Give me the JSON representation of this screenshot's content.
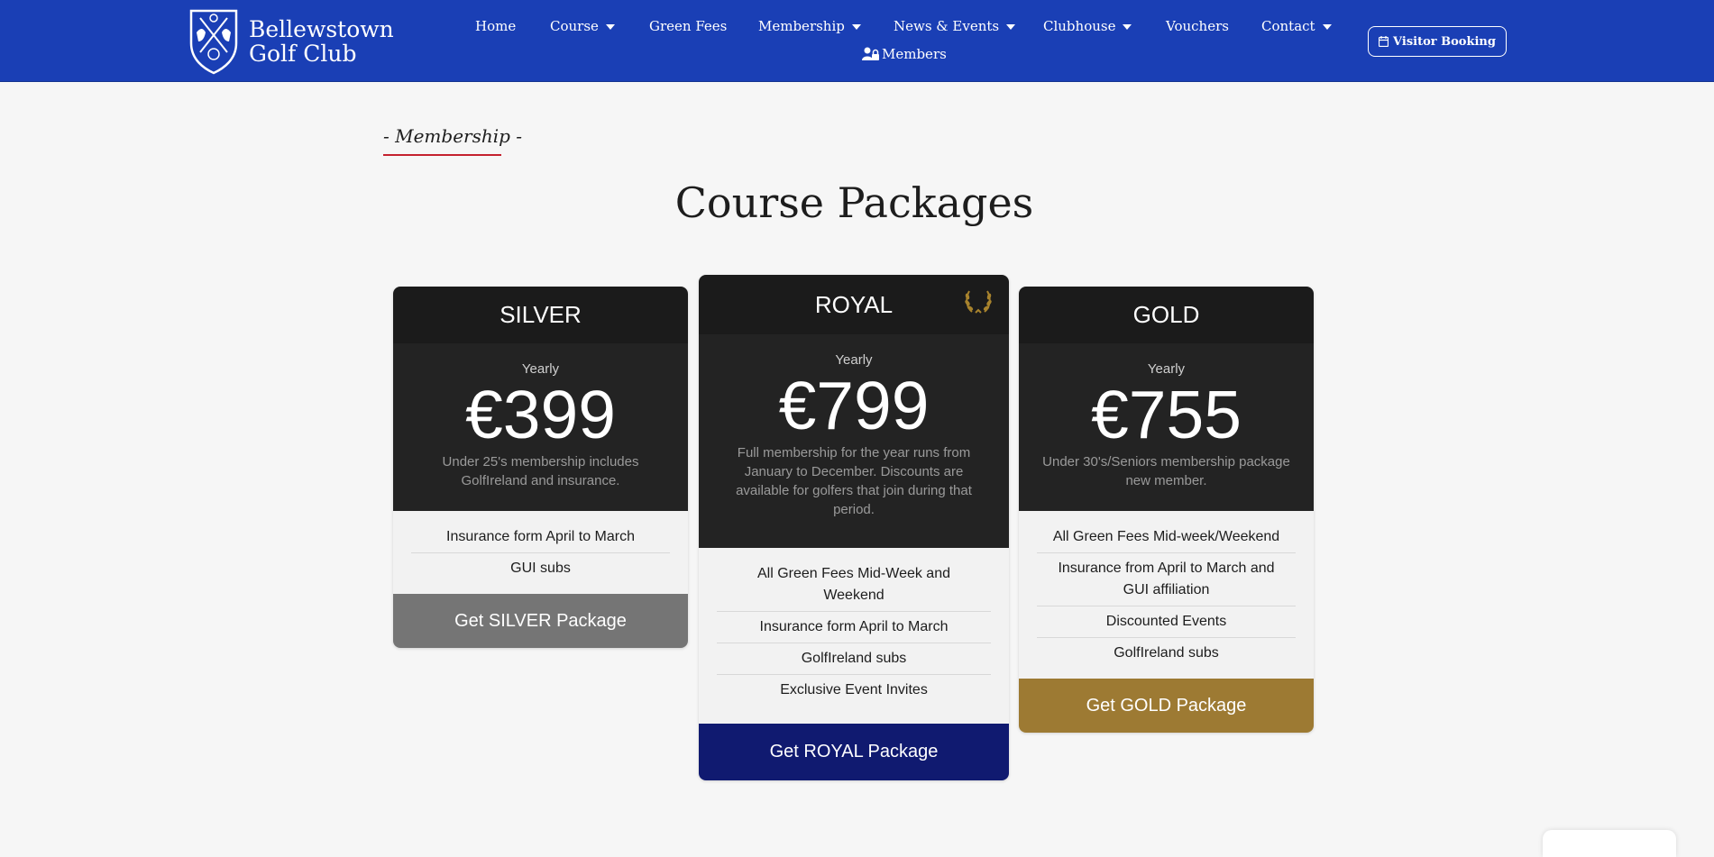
{
  "brand": {
    "name_line1": "Bellewstown",
    "name_line2": "Golf Club",
    "primary_color": "#1a3fb5"
  },
  "nav": {
    "items": [
      {
        "label": "Home",
        "has_dropdown": false
      },
      {
        "label": "Course",
        "has_dropdown": true
      },
      {
        "label": "Green Fees",
        "has_dropdown": false
      },
      {
        "label": "Membership",
        "has_dropdown": true
      },
      {
        "label": "News & Events",
        "has_dropdown": true
      },
      {
        "label": "Clubhouse",
        "has_dropdown": true
      },
      {
        "label": "Vouchers",
        "has_dropdown": false
      },
      {
        "label": "Contact",
        "has_dropdown": true
      }
    ],
    "members_label": "Members",
    "visitor_booking_label": "Visitor Booking"
  },
  "section": {
    "eyebrow": "- Membership -",
    "title": "Course Packages"
  },
  "packages": [
    {
      "name": "SILVER",
      "period": "Yearly",
      "price": "€399",
      "description": "Under 25's membership includes GolfIreland and insurance.",
      "features": [
        "Insurance form April to March",
        "GUI subs"
      ],
      "cta": "Get SILVER Package",
      "cta_color": "#757575"
    },
    {
      "name": "ROYAL",
      "period": "Yearly",
      "price": "€799",
      "description": "Full membership for the year runs from January to December. Discounts are available for golfers that join during that period.",
      "features": [
        "All Green Fees Mid-Week and Weekend",
        "Insurance form April to March",
        "GolfIreland subs",
        "Exclusive Event Invites"
      ],
      "cta": "Get ROYAL Package",
      "cta_color": "#101a70",
      "badge_icon": "laurel-wreath-icon"
    },
    {
      "name": "GOLD",
      "period": "Yearly",
      "price": "€755",
      "description": "Under 30's/Seniors membership package new member.",
      "features": [
        "All Green Fees Mid-week/Weekend",
        "Insurance from April to March and GUI affiliation",
        "Discounted Events",
        "GolfIreland subs"
      ],
      "cta": "Get GOLD Package",
      "cta_color": "#9d7a33"
    }
  ]
}
